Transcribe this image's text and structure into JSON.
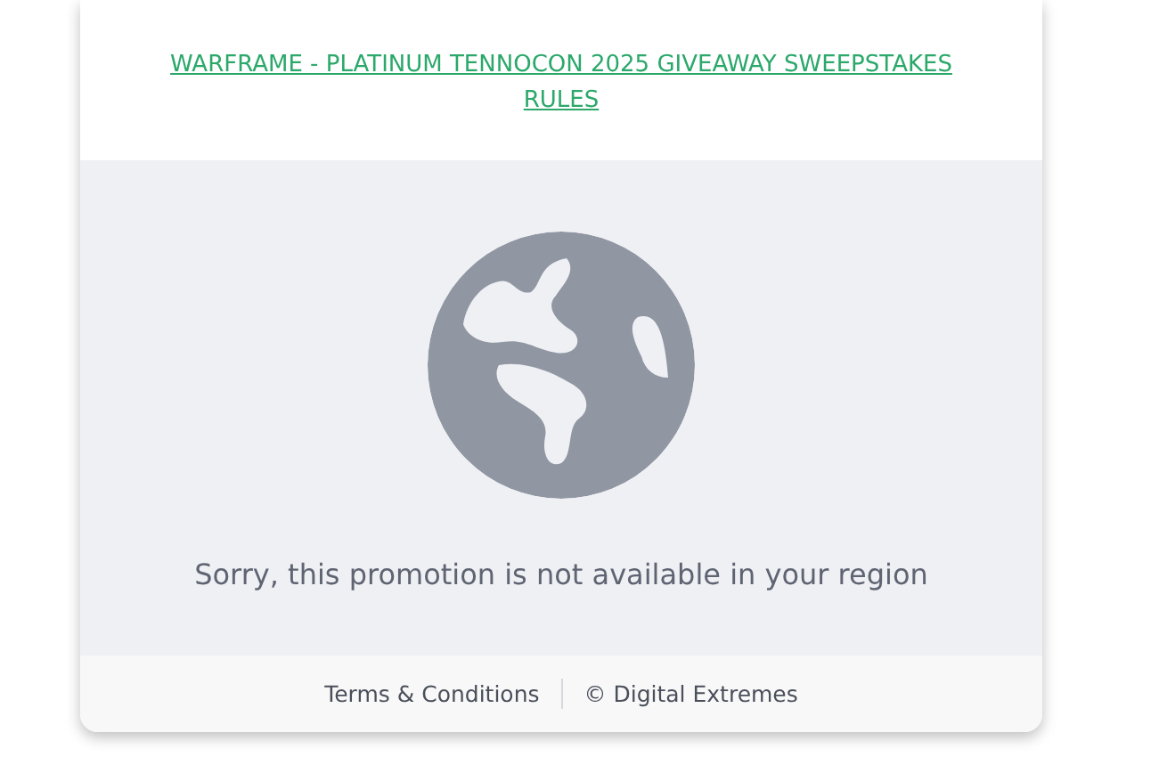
{
  "rules_link": "WARFRAME - PLATINUM TENNOCON 2025 GIVEAWAY SWEEPSTAKES RULES",
  "message": "Sorry, this promotion is not available in your region",
  "footer": {
    "terms_link": "Terms & Conditions",
    "copyright": "© Digital Extremes"
  }
}
